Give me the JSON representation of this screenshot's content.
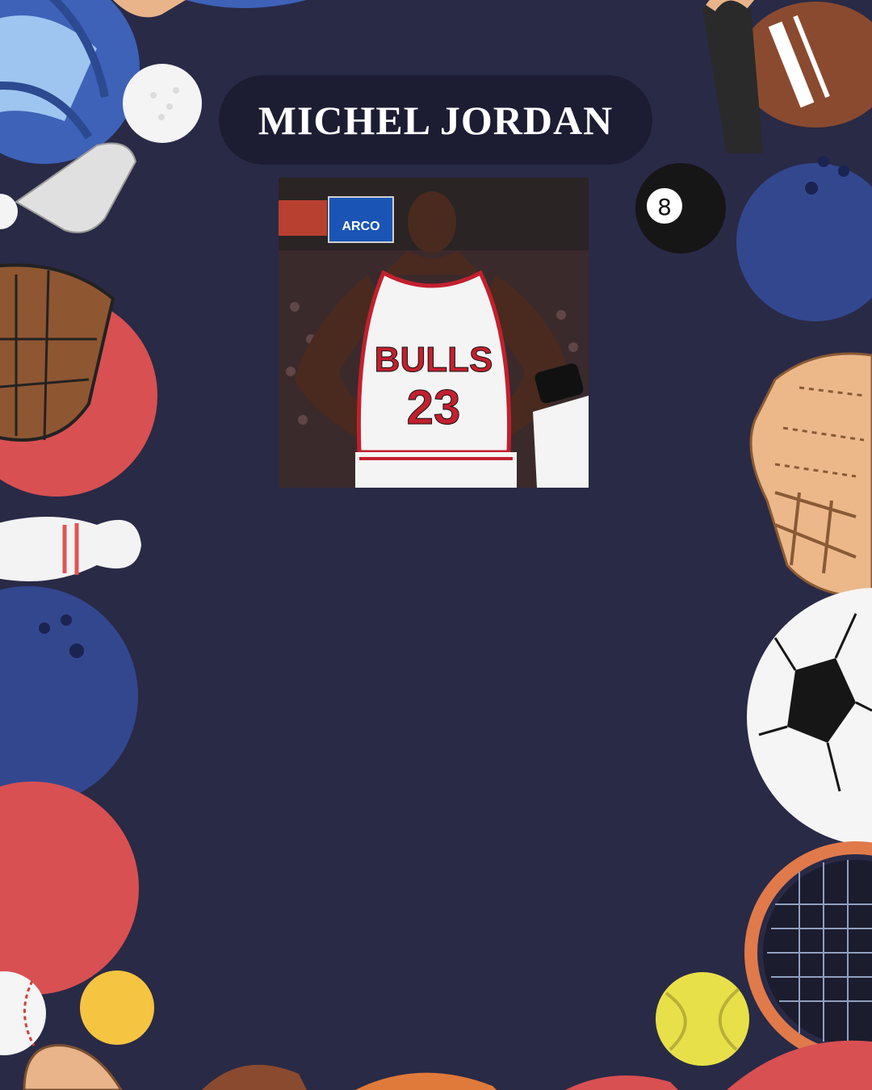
{
  "title": "MICHEL JORDAN",
  "photo": {
    "alt": "Michael Jordan in Chicago Bulls #23 jersey",
    "jersey_team": "BULLS",
    "jersey_number": "23",
    "sign_text": "ARCO"
  },
  "colors": {
    "background": "#292a46",
    "pill": "#1c1d33",
    "title_text": "#ffffff",
    "jersey_red": "#c2202e"
  },
  "decorations": [
    "volleyball-icon",
    "golf-ball-icon",
    "golf-club-icon",
    "football-icon",
    "bowling-ball-icon",
    "billiard-8-ball-icon",
    "baseball-glove-icon",
    "red-ball-icon",
    "bowling-pin-icon",
    "soccer-ball-icon",
    "tennis-racket-icon",
    "tennis-ball-icon",
    "baseball-icon",
    "basketball-icon"
  ]
}
